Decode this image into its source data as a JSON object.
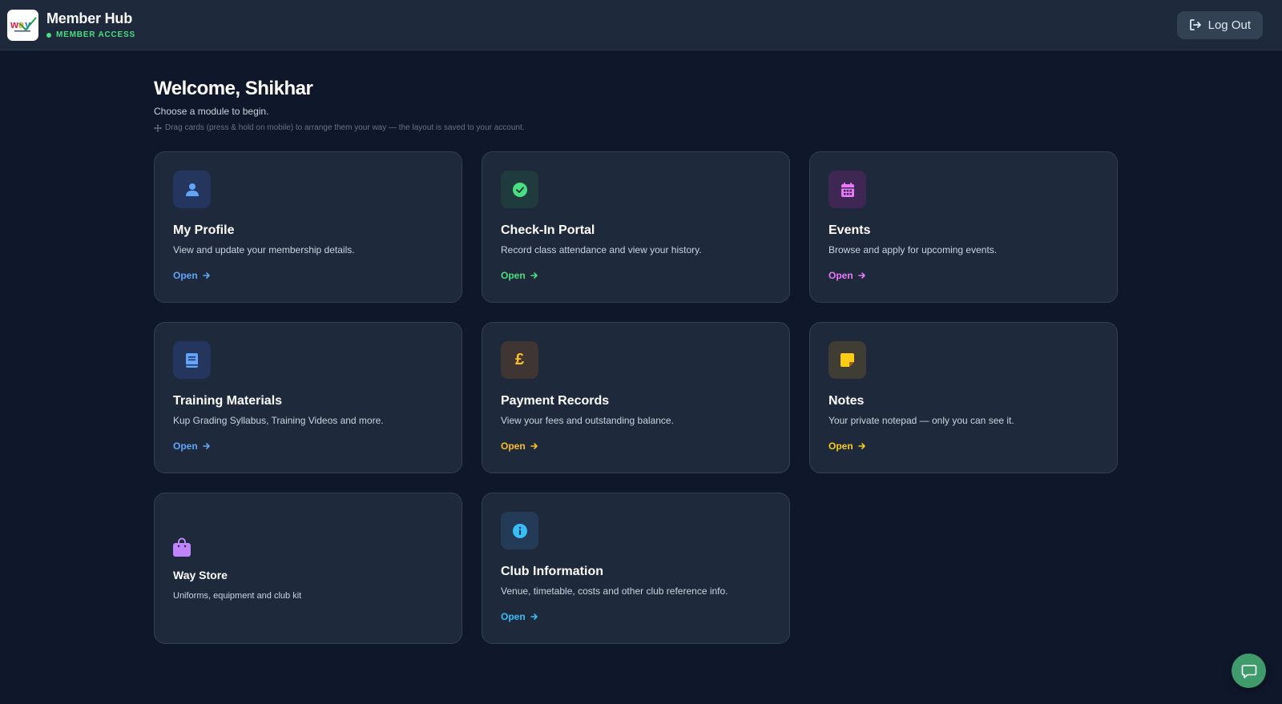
{
  "header": {
    "logo_icon": "way-logo-icon",
    "title": "Member Hub",
    "badge": "MEMBER ACCESS",
    "badge_color": "#4ade80",
    "logout_label": "Log Out"
  },
  "main": {
    "welcome": "Welcome, Shikhar",
    "subtitle": "Choose a module to begin.",
    "hint": "Drag cards (press & hold on mobile) to arrange them your way — the layout is saved to your account."
  },
  "cards": [
    {
      "title": "My Profile",
      "description": "View and update your membership details.",
      "link": "Open",
      "icon": "user-icon",
      "accent": "#60a5fa",
      "icon_bg": "#25365e"
    },
    {
      "title": "Check-In Portal",
      "description": "Record class attendance and view your history.",
      "link": "Open",
      "icon": "check-circle-icon",
      "accent": "#4ade80",
      "icon_bg": "#1f3b3d"
    },
    {
      "title": "Events",
      "description": "Browse and apply for upcoming events.",
      "link": "Open",
      "icon": "calendar-icon",
      "accent": "#e879f9",
      "icon_bg": "#3e2753"
    },
    {
      "title": "Training Materials",
      "description": "Kup Grading Syllabus, Training Videos and more.",
      "link": "Open",
      "icon": "book-icon",
      "accent": "#60a5fa",
      "icon_bg": "#25365e"
    },
    {
      "title": "Payment Records",
      "description": "View your fees and outstanding balance.",
      "link": "Open",
      "icon": "pound-icon",
      "accent": "#fbbf24",
      "icon_bg": "#3f3533"
    },
    {
      "title": "Notes",
      "description": "Your private notepad — only you can see it.",
      "link": "Open",
      "icon": "sticky-note-icon",
      "accent": "#facc15",
      "icon_bg": "#403d35"
    },
    {
      "title": "Way Store",
      "description": "Uniforms, equipment and club kit",
      "icon": "shopping-bag-icon",
      "accent": "#c084fc"
    },
    {
      "title": "Club Information",
      "description": "Venue, timetable, costs and other club reference info.",
      "link": "Open",
      "icon": "info-icon",
      "accent": "#38bdf8",
      "icon_bg": "#233b57"
    }
  ],
  "chat": {
    "icon": "chat-bubble-icon",
    "color": "#3f9b6c"
  }
}
